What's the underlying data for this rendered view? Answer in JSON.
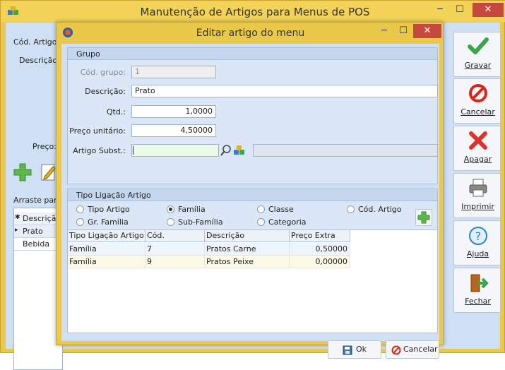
{
  "outer": {
    "title": "Manutenção de Artigos para Menus de POS",
    "labels": {
      "cod_artigo": "Cód. Artigo:",
      "descricao": "Descrição:",
      "preco": "Preço:",
      "arraste": "Arraste para"
    },
    "list_items": [
      {
        "marker": "✱",
        "text": "Descrição"
      },
      {
        "marker": "▸",
        "text": "Prato"
      },
      {
        "marker": "",
        "text": "Bebida"
      }
    ],
    "toolbar": {
      "gravar": "Gravar",
      "cancelar": "Cancelar",
      "apagar": "Apagar",
      "imprimir": "Imprimir",
      "ajuda": "Ajuda",
      "fechar": "Fechar"
    },
    "window_controls": {
      "minimize": "─",
      "maximize": "☐",
      "close": "✕"
    }
  },
  "dialog": {
    "title": "Editar artigo do menu",
    "window_controls": {
      "minimize": "─",
      "maximize": "☐",
      "close": "✕"
    },
    "grupo": {
      "title": "Grupo",
      "cod_grupo_label": "Cód. grupo:",
      "cod_grupo_value": "1",
      "descricao_label": "Descrição:",
      "descricao_value": "Prato",
      "qtd_label": "Qtd.:",
      "qtd_value": "1,0000",
      "preco_label": "Preço unitário:",
      "preco_value": "4,50000",
      "artigo_subst_label": "Artigo Subst.:",
      "artigo_subst_value": "",
      "artigo_desc_value": ""
    },
    "ligacao": {
      "title": "Tipo Ligação Artigo",
      "options": [
        {
          "label": "Tipo Artigo",
          "selected": false
        },
        {
          "label": "Família",
          "selected": true
        },
        {
          "label": "Classe",
          "selected": false
        },
        {
          "label": "Cód. Artigo",
          "selected": false
        },
        {
          "label": "Gr. Família",
          "selected": false
        },
        {
          "label": "Sub-Família",
          "selected": false
        },
        {
          "label": "Categoria",
          "selected": false
        }
      ],
      "columns": [
        "Tipo Ligação Artigo",
        "Cód.",
        "Descrição",
        "Preço Extra"
      ],
      "rows": [
        [
          "Família",
          "7",
          "Pratos Carne",
          "0,50000"
        ],
        [
          "Família",
          "9",
          "Pratos Peixe",
          "0,00000"
        ]
      ]
    },
    "buttons": {
      "ok": "Ok",
      "cancelar": "Cancelar"
    }
  }
}
